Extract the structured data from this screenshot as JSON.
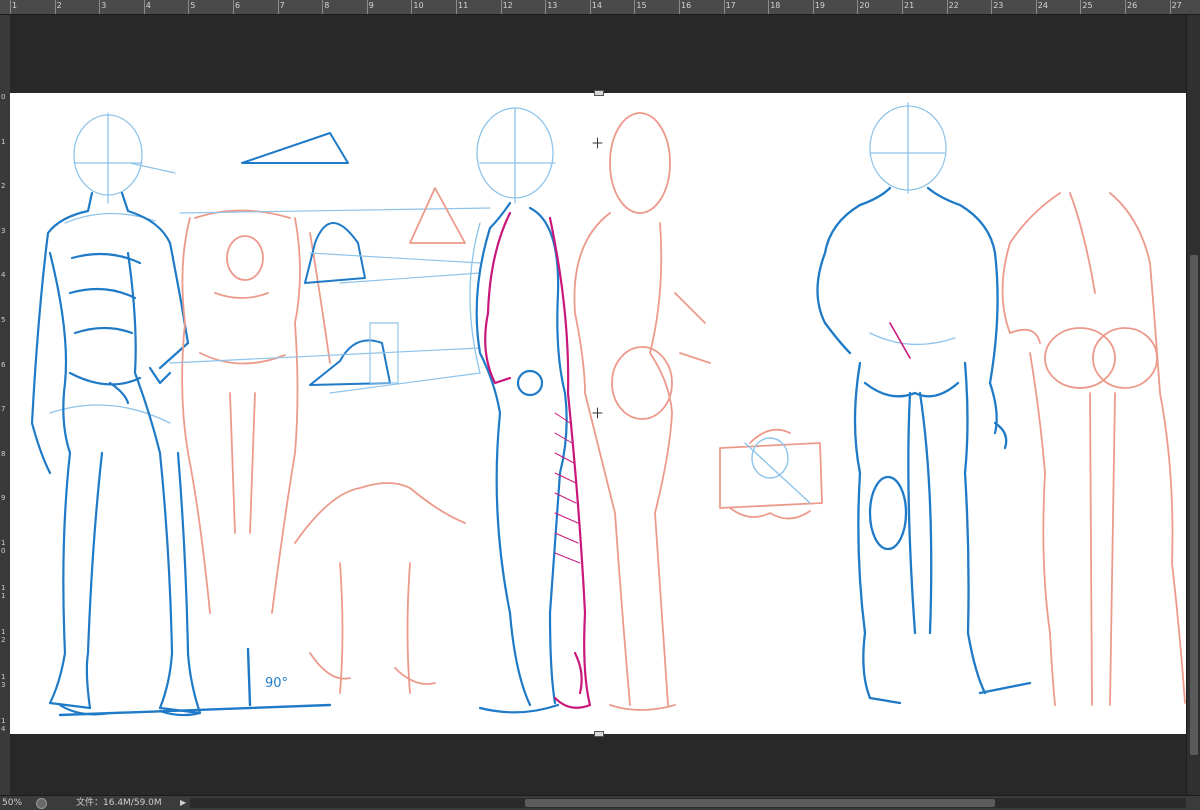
{
  "ruler": {
    "ticks": [
      "1",
      "2",
      "3",
      "4",
      "5",
      "6",
      "7",
      "8",
      "9",
      "10",
      "11",
      "12",
      "13",
      "14",
      "15",
      "16",
      "17",
      "18",
      "19",
      "20",
      "21",
      "22",
      "23",
      "24",
      "25",
      "26",
      "27"
    ],
    "vticks": [
      "0",
      "1",
      "2",
      "3",
      "4",
      "5",
      "6",
      "7",
      "8",
      "9",
      "1 0",
      "1 1",
      "1 2",
      "1 3",
      "1 4"
    ]
  },
  "status": {
    "zoom": "50%",
    "doc_info": "文件：16.4M/59.0M",
    "menu_arrow": "▶"
  },
  "canvas": {
    "annotation": "90°"
  },
  "colors": {
    "blue": "#1f7ac7",
    "light_blue": "#8fc4ea",
    "salmon": "#ec9a8b",
    "magenta": "#c8187c"
  }
}
